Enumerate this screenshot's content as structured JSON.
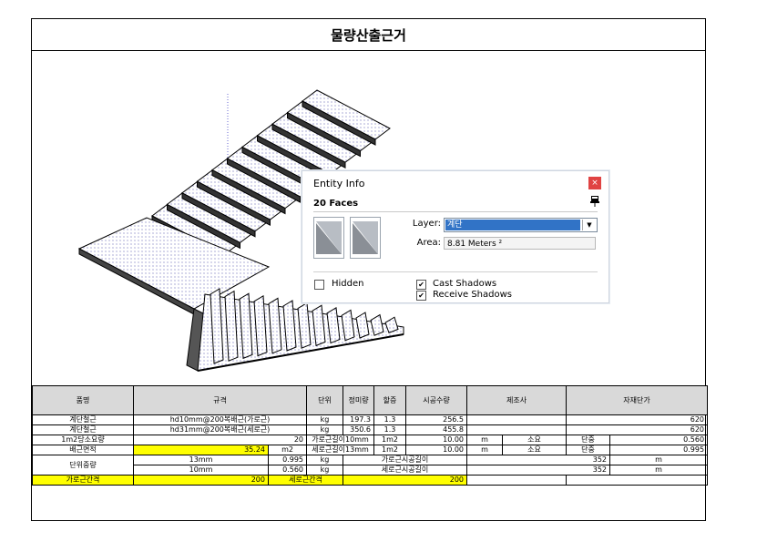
{
  "title": "물량산출근거",
  "dialog": {
    "caption": "Entity Info",
    "close_glyph": "×",
    "faces": "20 Faces",
    "layer_label": "Layer:",
    "layer_value": "계단",
    "dropdown_glyph": "▼",
    "area_label": "Area:",
    "area_value": "8.81 Meters ²",
    "hidden_label": "Hidden",
    "hidden_checked": false,
    "cast_label": "Cast Shadows",
    "cast_checked": true,
    "receive_label": "Receive Shadows",
    "receive_checked": true,
    "check_glyph": "✔"
  },
  "table": {
    "headers": {
      "name": "품명",
      "spec": "규격",
      "unit": "단위",
      "net": "정미량",
      "loss": "할증",
      "qty": "시공수량",
      "maker": "제조사",
      "price": "자재단가"
    },
    "rows": [
      {
        "name": "계단철근",
        "spec": "hd10mm@200복배근(가로근)",
        "unit": "kg",
        "net": "197.3",
        "loss": "1.3",
        "qty": "256.5",
        "price": "620"
      },
      {
        "name": "계단철근",
        "spec": "hd31mm@200복배근(세로근)",
        "unit": "kg",
        "net": "350.6",
        "loss": "1.3",
        "qty": "455.8",
        "price": "620"
      }
    ],
    "r3": {
      "name": "1m2당소요량",
      "v1": "20",
      "lbl": "가로근길이10mm",
      "u": "1m2",
      "v2": "10.00",
      "m": "m",
      "s": "소요",
      "dj": "단중",
      "w": "0.560"
    },
    "r4": {
      "name": "배근면적",
      "v1": "35.24",
      "u1": "m2",
      "lbl": "세로근길이13mm",
      "u": "1m2",
      "v2": "10.00",
      "m": "m",
      "s": "소요",
      "dj": "단중",
      "w": "0.995"
    },
    "r5": {
      "name": "단위중량",
      "a": "13mm",
      "av": "0.995",
      "au": "kg",
      "alabel": "가로근시공길이",
      "aval": "352",
      "am": "m",
      "b": "10mm",
      "bv": "0.560",
      "bu": "kg",
      "blabel": "세로근시공길이",
      "bval": "352",
      "bm": "m"
    },
    "r6": {
      "l1": "가로근간격",
      "v1": "200",
      "l2": "세로근간격",
      "v2": "200"
    }
  }
}
